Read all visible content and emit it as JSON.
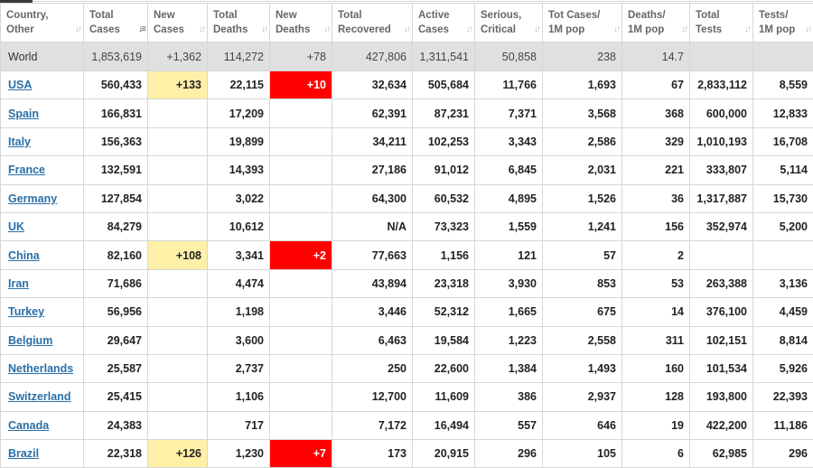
{
  "columns": [
    {
      "key": "country",
      "lines": [
        "Country,",
        "Other"
      ],
      "sort": "↓↑",
      "active": false
    },
    {
      "key": "total_cases",
      "lines": [
        "Total",
        "Cases"
      ],
      "sort": "↓≡",
      "active": true
    },
    {
      "key": "new_cases",
      "lines": [
        "New",
        "Cases"
      ],
      "sort": "↓↑",
      "active": false
    },
    {
      "key": "total_deaths",
      "lines": [
        "Total",
        "Deaths"
      ],
      "sort": "↓↑",
      "active": false
    },
    {
      "key": "new_deaths",
      "lines": [
        "New",
        "Deaths"
      ],
      "sort": "↓↑",
      "active": false
    },
    {
      "key": "total_recovered",
      "lines": [
        "Total",
        "Recovered"
      ],
      "sort": "↓↑",
      "active": false
    },
    {
      "key": "active_cases",
      "lines": [
        "Active",
        "Cases"
      ],
      "sort": "↓↑",
      "active": false
    },
    {
      "key": "serious_critical",
      "lines": [
        "Serious,",
        "Critical"
      ],
      "sort": "↓↑",
      "active": false
    },
    {
      "key": "tot_cases_1m",
      "lines": [
        "Tot Cases/",
        "1M pop"
      ],
      "sort": "↓↑",
      "active": false
    },
    {
      "key": "deaths_1m",
      "lines": [
        "Deaths/",
        "1M pop"
      ],
      "sort": "↓↑",
      "active": false
    },
    {
      "key": "total_tests",
      "lines": [
        "Total",
        "Tests"
      ],
      "sort": "↓↑",
      "active": false
    },
    {
      "key": "tests_1m",
      "lines": [
        "Tests/",
        "1M pop"
      ],
      "sort": "↓↑",
      "active": false
    }
  ],
  "world": {
    "country": "World",
    "total_cases": "1,853,619",
    "new_cases": "+1,362",
    "total_deaths": "114,272",
    "new_deaths": "+78",
    "total_recovered": "427,806",
    "active_cases": "1,311,541",
    "serious_critical": "50,858",
    "tot_cases_1m": "238",
    "deaths_1m": "14.7",
    "total_tests": "",
    "tests_1m": ""
  },
  "rows": [
    {
      "country": "USA",
      "total_cases": "560,433",
      "new_cases": "+133",
      "total_deaths": "22,115",
      "new_deaths": "+10",
      "total_recovered": "32,634",
      "active_cases": "505,684",
      "serious_critical": "11,766",
      "tot_cases_1m": "1,693",
      "deaths_1m": "67",
      "total_tests": "2,833,112",
      "tests_1m": "8,559"
    },
    {
      "country": "Spain",
      "total_cases": "166,831",
      "new_cases": "",
      "total_deaths": "17,209",
      "new_deaths": "",
      "total_recovered": "62,391",
      "active_cases": "87,231",
      "serious_critical": "7,371",
      "tot_cases_1m": "3,568",
      "deaths_1m": "368",
      "total_tests": "600,000",
      "tests_1m": "12,833"
    },
    {
      "country": "Italy",
      "total_cases": "156,363",
      "new_cases": "",
      "total_deaths": "19,899",
      "new_deaths": "",
      "total_recovered": "34,211",
      "active_cases": "102,253",
      "serious_critical": "3,343",
      "tot_cases_1m": "2,586",
      "deaths_1m": "329",
      "total_tests": "1,010,193",
      "tests_1m": "16,708"
    },
    {
      "country": "France",
      "total_cases": "132,591",
      "new_cases": "",
      "total_deaths": "14,393",
      "new_deaths": "",
      "total_recovered": "27,186",
      "active_cases": "91,012",
      "serious_critical": "6,845",
      "tot_cases_1m": "2,031",
      "deaths_1m": "221",
      "total_tests": "333,807",
      "tests_1m": "5,114"
    },
    {
      "country": "Germany",
      "total_cases": "127,854",
      "new_cases": "",
      "total_deaths": "3,022",
      "new_deaths": "",
      "total_recovered": "64,300",
      "active_cases": "60,532",
      "serious_critical": "4,895",
      "tot_cases_1m": "1,526",
      "deaths_1m": "36",
      "total_tests": "1,317,887",
      "tests_1m": "15,730"
    },
    {
      "country": "UK",
      "total_cases": "84,279",
      "new_cases": "",
      "total_deaths": "10,612",
      "new_deaths": "",
      "total_recovered": "N/A",
      "active_cases": "73,323",
      "serious_critical": "1,559",
      "tot_cases_1m": "1,241",
      "deaths_1m": "156",
      "total_tests": "352,974",
      "tests_1m": "5,200"
    },
    {
      "country": "China",
      "total_cases": "82,160",
      "new_cases": "+108",
      "total_deaths": "3,341",
      "new_deaths": "+2",
      "total_recovered": "77,663",
      "active_cases": "1,156",
      "serious_critical": "121",
      "tot_cases_1m": "57",
      "deaths_1m": "2",
      "total_tests": "",
      "tests_1m": ""
    },
    {
      "country": "Iran",
      "total_cases": "71,686",
      "new_cases": "",
      "total_deaths": "4,474",
      "new_deaths": "",
      "total_recovered": "43,894",
      "active_cases": "23,318",
      "serious_critical": "3,930",
      "tot_cases_1m": "853",
      "deaths_1m": "53",
      "total_tests": "263,388",
      "tests_1m": "3,136"
    },
    {
      "country": "Turkey",
      "total_cases": "56,956",
      "new_cases": "",
      "total_deaths": "1,198",
      "new_deaths": "",
      "total_recovered": "3,446",
      "active_cases": "52,312",
      "serious_critical": "1,665",
      "tot_cases_1m": "675",
      "deaths_1m": "14",
      "total_tests": "376,100",
      "tests_1m": "4,459"
    },
    {
      "country": "Belgium",
      "total_cases": "29,647",
      "new_cases": "",
      "total_deaths": "3,600",
      "new_deaths": "",
      "total_recovered": "6,463",
      "active_cases": "19,584",
      "serious_critical": "1,223",
      "tot_cases_1m": "2,558",
      "deaths_1m": "311",
      "total_tests": "102,151",
      "tests_1m": "8,814"
    },
    {
      "country": "Netherlands",
      "total_cases": "25,587",
      "new_cases": "",
      "total_deaths": "2,737",
      "new_deaths": "",
      "total_recovered": "250",
      "active_cases": "22,600",
      "serious_critical": "1,384",
      "tot_cases_1m": "1,493",
      "deaths_1m": "160",
      "total_tests": "101,534",
      "tests_1m": "5,926"
    },
    {
      "country": "Switzerland",
      "total_cases": "25,415",
      "new_cases": "",
      "total_deaths": "1,106",
      "new_deaths": "",
      "total_recovered": "12,700",
      "active_cases": "11,609",
      "serious_critical": "386",
      "tot_cases_1m": "2,937",
      "deaths_1m": "128",
      "total_tests": "193,800",
      "tests_1m": "22,393"
    },
    {
      "country": "Canada",
      "total_cases": "24,383",
      "new_cases": "",
      "total_deaths": "717",
      "new_deaths": "",
      "total_recovered": "7,172",
      "active_cases": "16,494",
      "serious_critical": "557",
      "tot_cases_1m": "646",
      "deaths_1m": "19",
      "total_tests": "422,200",
      "tests_1m": "11,186"
    },
    {
      "country": "Brazil",
      "total_cases": "22,318",
      "new_cases": "+126",
      "total_deaths": "1,230",
      "new_deaths": "+7",
      "total_recovered": "173",
      "active_cases": "20,915",
      "serious_critical": "296",
      "tot_cases_1m": "105",
      "deaths_1m": "6",
      "total_tests": "62,985",
      "tests_1m": "296"
    }
  ],
  "colors": {
    "new_cases_highlight": "#fff0a8",
    "new_deaths_highlight": "#ff0000",
    "world_row_bg": "#e0e0e0",
    "country_link": "#2a6fa8"
  }
}
